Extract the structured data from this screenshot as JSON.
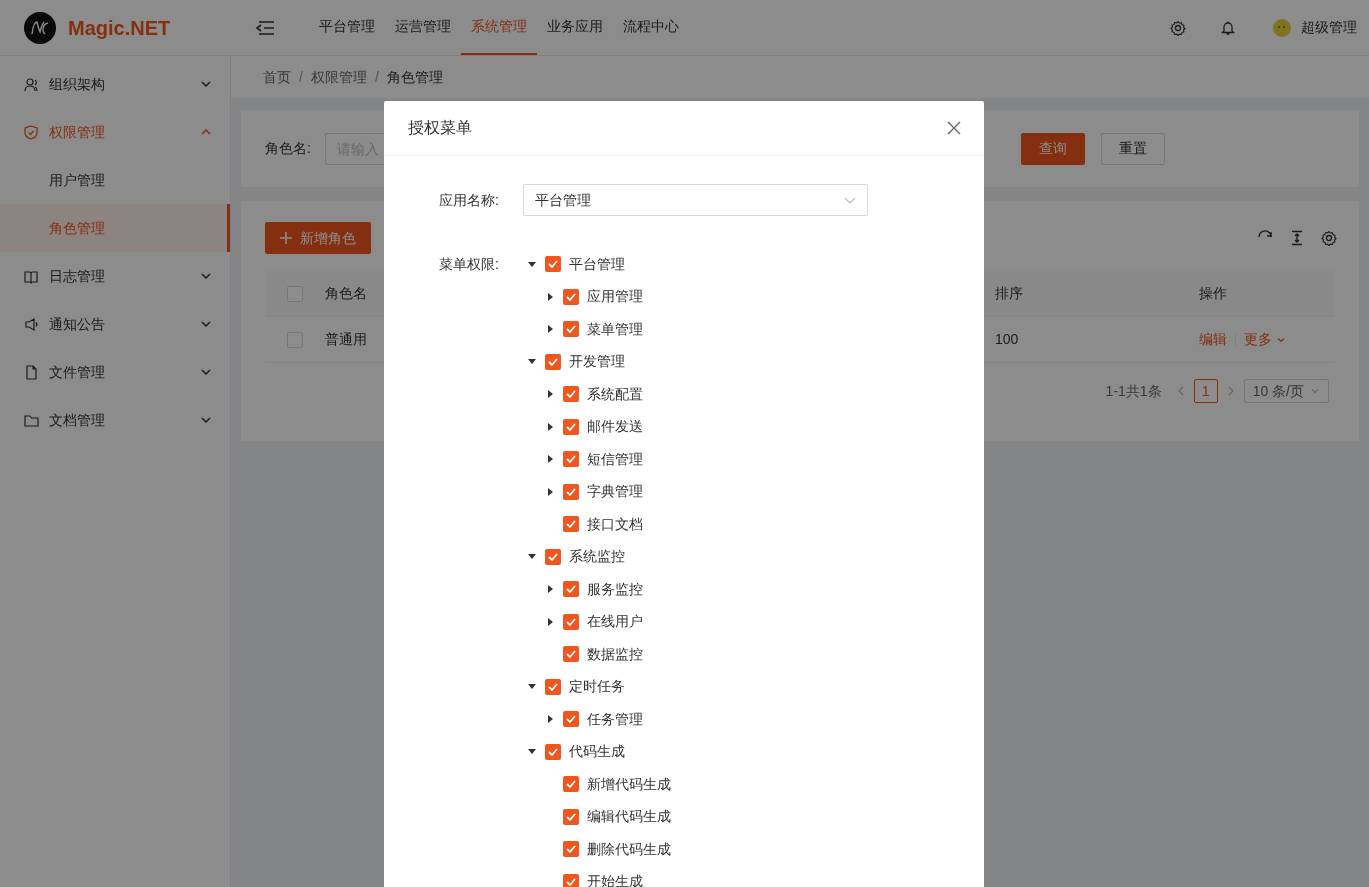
{
  "header": {
    "brand": "Magic.NET",
    "nav": [
      {
        "label": "平台管理",
        "selected": false
      },
      {
        "label": "运营管理",
        "selected": false
      },
      {
        "label": "系统管理",
        "selected": true
      },
      {
        "label": "业务应用",
        "selected": false
      },
      {
        "label": "流程中心",
        "selected": false
      }
    ],
    "user": "超级管理"
  },
  "sidebar": {
    "items": [
      {
        "label": "组织架构",
        "expanded": false,
        "selected": false
      },
      {
        "label": "权限管理",
        "expanded": true,
        "selected": true,
        "children": [
          {
            "label": "用户管理",
            "selected": false
          },
          {
            "label": "角色管理",
            "selected": true
          }
        ]
      },
      {
        "label": "日志管理",
        "expanded": false,
        "selected": false
      },
      {
        "label": "通知公告",
        "expanded": false,
        "selected": false
      },
      {
        "label": "文件管理",
        "expanded": false,
        "selected": false
      },
      {
        "label": "文档管理",
        "expanded": false,
        "selected": false
      }
    ]
  },
  "breadcrumb": {
    "items": [
      "首页",
      "权限管理",
      "角色管理"
    ],
    "separator": "/"
  },
  "search": {
    "label": "角色名:",
    "placeholder": "请输入",
    "buttons": [
      "查询",
      "重置"
    ]
  },
  "toolbar": {
    "add_button": "新增角色"
  },
  "table": {
    "columns": [
      {
        "label": "角色名",
        "checked": false
      },
      {
        "label": "排序"
      },
      {
        "label": "操作"
      }
    ],
    "rows": [
      {
        "checked": false,
        "name": "普通用",
        "sort": "100",
        "actions": [
          "编辑",
          "更多"
        ]
      }
    ]
  },
  "pagination": {
    "summary": "1-1共1条",
    "pages": [
      {
        "label": "1",
        "selected": true
      }
    ],
    "page_size": "10 条/页"
  },
  "modal": {
    "title": "授权菜单",
    "app_label": "应用名称:",
    "app_value": "平台管理",
    "menu_label": "菜单权限:",
    "tree": [
      {
        "label": "平台管理",
        "checked": true,
        "expanded": true,
        "children": [
          {
            "label": "应用管理",
            "checked": true,
            "expanded": false
          },
          {
            "label": "菜单管理",
            "checked": true,
            "expanded": false
          }
        ]
      },
      {
        "label": "开发管理",
        "checked": true,
        "expanded": true,
        "children": [
          {
            "label": "系统配置",
            "checked": true,
            "expanded": false
          },
          {
            "label": "邮件发送",
            "checked": true,
            "expanded": false
          },
          {
            "label": "短信管理",
            "checked": true,
            "expanded": false
          },
          {
            "label": "字典管理",
            "checked": true,
            "expanded": false
          },
          {
            "label": "接口文档",
            "checked": true
          }
        ]
      },
      {
        "label": "系统监控",
        "checked": true,
        "expanded": true,
        "children": [
          {
            "label": "服务监控",
            "checked": true,
            "expanded": false
          },
          {
            "label": "在线用户",
            "checked": true,
            "expanded": false
          },
          {
            "label": "数据监控",
            "checked": true
          }
        ]
      },
      {
        "label": "定时任务",
        "checked": true,
        "expanded": true,
        "children": [
          {
            "label": "任务管理",
            "checked": true,
            "expanded": false
          }
        ]
      },
      {
        "label": "代码生成",
        "checked": true,
        "expanded": true,
        "children": [
          {
            "label": "新增代码生成",
            "checked": true
          },
          {
            "label": "编辑代码生成",
            "checked": true
          },
          {
            "label": "删除代码生成",
            "checked": true
          },
          {
            "label": "开始生成",
            "checked": true
          }
        ]
      }
    ]
  }
}
